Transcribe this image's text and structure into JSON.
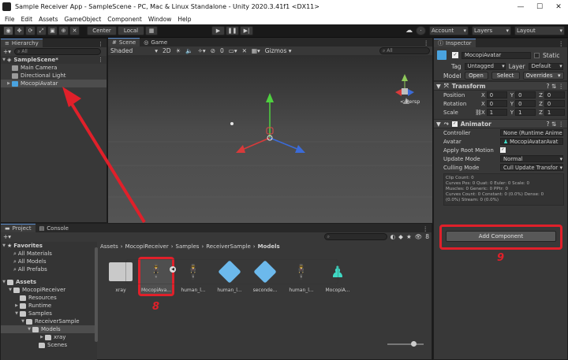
{
  "window": {
    "title": "Sample Receiver App - SampleScene - PC, Mac & Linux Standalone - Unity 2020.3.41f1 <DX11>",
    "minimize": "—",
    "maximize": "☐",
    "close": "✕"
  },
  "menu": [
    "File",
    "Edit",
    "Assets",
    "GameObject",
    "Component",
    "Window",
    "Help"
  ],
  "toolbar": {
    "pivot_center": "Center",
    "pivot_local": "Local",
    "account": "Account",
    "layers": "Layers",
    "layout": "Layout"
  },
  "hierarchy": {
    "tab": "Hierarchy",
    "search_placeholder": "All",
    "scene": "SampleScene*",
    "items": [
      "Main Camera",
      "Directional Light",
      "MocopiAvatar"
    ]
  },
  "scene": {
    "tab_scene": "Scene",
    "tab_game": "Game",
    "shading": "Shaded",
    "mode_2d": "2D",
    "fx_count": "0",
    "gizmos": "Gizmos",
    "search_placeholder": "All",
    "persp": "< Persp"
  },
  "project": {
    "tab_project": "Project",
    "tab_console": "Console",
    "breadcrumb": [
      "Assets",
      "MocopiReceiver",
      "Samples",
      "ReceiverSample",
      "Models"
    ],
    "count": "8",
    "tree": {
      "favorites": "Favorites",
      "fav_items": [
        "All Materials",
        "All Models",
        "All Prefabs"
      ],
      "assets": "Assets",
      "mocopi": "MocopiReceiver",
      "resources": "Resources",
      "runtime": "Runtime",
      "samples": "Samples",
      "receiversample": "ReceiverSample",
      "models": "Models",
      "xray": "xray",
      "scenes": "Scenes"
    },
    "assets": [
      "xray",
      "MocopiAva...",
      "human_l...",
      "human_l...",
      "seconde...",
      "human_l...",
      "MocopiA..."
    ]
  },
  "inspector": {
    "tab": "Inspector",
    "object_name": "MocopiAvatar",
    "static_label": "Static",
    "tag_label": "Tag",
    "tag_value": "Untagged",
    "layer_label": "Layer",
    "layer_value": "Default",
    "model_label": "Model",
    "open": "Open",
    "select": "Select",
    "overrides": "Overrides",
    "transform": {
      "title": "Transform",
      "position_label": "Position",
      "rotation_label": "Rotation",
      "scale_label": "Scale",
      "axes": [
        "X",
        "Y",
        "Z"
      ],
      "position": [
        "0",
        "0",
        "0"
      ],
      "rotation": [
        "0",
        "0",
        "0"
      ],
      "scale": [
        "1",
        "1",
        "1"
      ]
    },
    "animator": {
      "title": "Animator",
      "controller_label": "Controller",
      "controller_value": "None (Runtime Anime",
      "avatar_label": "Avatar",
      "avatar_value": "MocopiAvatarAvat",
      "root_motion_label": "Apply Root Motion",
      "update_mode_label": "Update Mode",
      "update_mode_value": "Normal",
      "culling_label": "Culling Mode",
      "culling_value": "Cull Update Transfor",
      "info_lines": [
        "Clip Count: 0",
        "Curves Pos: 0 Quat: 0 Euler: 0 Scale: 0",
        "Muscles: 0 Generic: 0 PPtr: 0",
        "Curves Count: 0 Constant: 0 (0.0%) Dense: 0",
        "(0.0%) Stream: 0 (0.0%)"
      ]
    },
    "add_component": "Add Component"
  },
  "annotations": {
    "label_8": "8",
    "label_9": "9"
  },
  "colors": {
    "accent_red": "#e0202a",
    "selection_blue": "#5b8ed1"
  }
}
